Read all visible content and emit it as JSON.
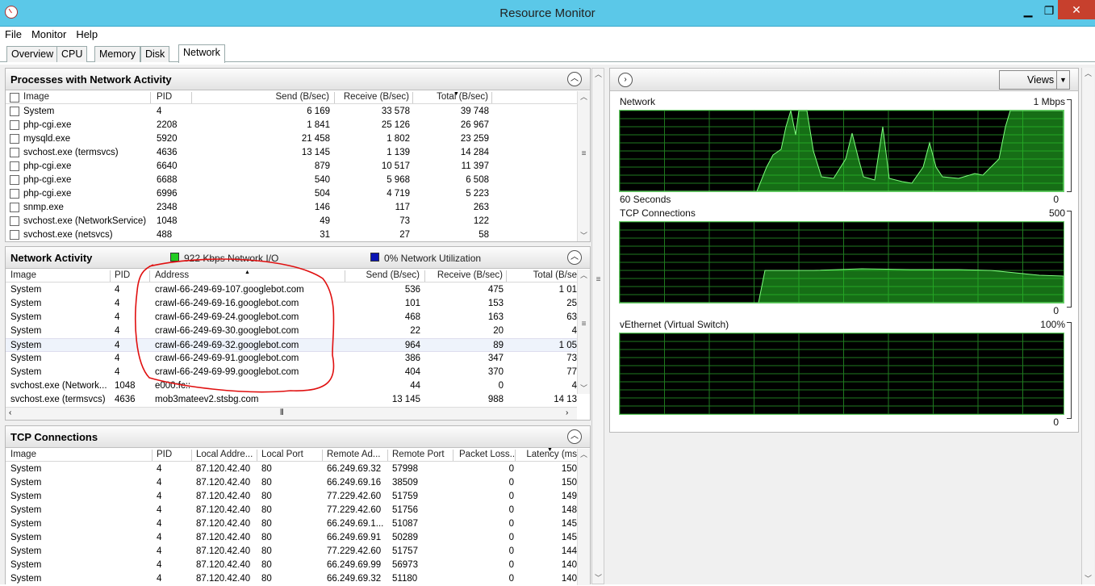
{
  "window": {
    "title": "Resource Monitor",
    "min": "▁",
    "max": "❐",
    "close": "✕"
  },
  "menu": [
    "File",
    "Monitor",
    "Help"
  ],
  "tabs": [
    "Overview",
    "CPU",
    "Memory",
    "Disk",
    "Network"
  ],
  "processes": {
    "title": "Processes with Network Activity",
    "columns": [
      "Image",
      "PID",
      "Send (B/sec)",
      "Receive (B/sec)",
      "Total (B/sec)"
    ],
    "rows": [
      [
        "System",
        "4",
        "6 169",
        "33 578",
        "39 748"
      ],
      [
        "php-cgi.exe",
        "2208",
        "1 841",
        "25 126",
        "26 967"
      ],
      [
        "mysqld.exe",
        "5920",
        "21 458",
        "1 802",
        "23 259"
      ],
      [
        "svchost.exe (termsvcs)",
        "4636",
        "13 145",
        "1 139",
        "14 284"
      ],
      [
        "php-cgi.exe",
        "6640",
        "879",
        "10 517",
        "11 397"
      ],
      [
        "php-cgi.exe",
        "6688",
        "540",
        "5 968",
        "6 508"
      ],
      [
        "php-cgi.exe",
        "6996",
        "504",
        "4 719",
        "5 223"
      ],
      [
        "snmp.exe",
        "2348",
        "146",
        "117",
        "263"
      ],
      [
        "svchost.exe (NetworkService)",
        "1048",
        "49",
        "73",
        "122"
      ],
      [
        "svchost.exe (netsvcs)",
        "488",
        "31",
        "27",
        "58"
      ]
    ]
  },
  "activity": {
    "title": "Network Activity",
    "io_legend": "922 Kbps Network I/O",
    "util_legend": "0% Network Utilization",
    "io_color": "#22cc22",
    "util_color": "#0a14b4",
    "columns": [
      "Image",
      "PID",
      "Address",
      "Send (B/sec)",
      "Receive (B/sec)",
      "Total (B/se"
    ],
    "rows": [
      [
        "System",
        "4",
        "crawl-66-249-69-107.googlebot.com",
        "536",
        "475",
        "1 01"
      ],
      [
        "System",
        "4",
        "crawl-66-249-69-16.googlebot.com",
        "101",
        "153",
        "25"
      ],
      [
        "System",
        "4",
        "crawl-66-249-69-24.googlebot.com",
        "468",
        "163",
        "63"
      ],
      [
        "System",
        "4",
        "crawl-66-249-69-30.googlebot.com",
        "22",
        "20",
        "4"
      ],
      [
        "System",
        "4",
        "crawl-66-249-69-32.googlebot.com",
        "964",
        "89",
        "1 05"
      ],
      [
        "System",
        "4",
        "crawl-66-249-69-91.googlebot.com",
        "386",
        "347",
        "73"
      ],
      [
        "System",
        "4",
        "crawl-66-249-69-99.googlebot.com",
        "404",
        "370",
        "77"
      ],
      [
        "svchost.exe (Network...",
        "1048",
        "e000:fc::",
        "44",
        "0",
        "4"
      ],
      [
        "svchost.exe (termsvcs)",
        "4636",
        "mob3mateev2.stsbg.com",
        "13 145",
        "988",
        "14 13"
      ]
    ]
  },
  "tcp": {
    "title": "TCP Connections",
    "columns": [
      "Image",
      "PID",
      "Local Addre...",
      "Local Port",
      "Remote Ad...",
      "Remote Port",
      "Packet Loss...",
      "Latency (ms"
    ],
    "rows": [
      [
        "System",
        "4",
        "87.120.42.40",
        "80",
        "66.249.69.32",
        "57998",
        "0",
        "150"
      ],
      [
        "System",
        "4",
        "87.120.42.40",
        "80",
        "66.249.69.16",
        "38509",
        "0",
        "150"
      ],
      [
        "System",
        "4",
        "87.120.42.40",
        "80",
        "77.229.42.60",
        "51759",
        "0",
        "149"
      ],
      [
        "System",
        "4",
        "87.120.42.40",
        "80",
        "77.229.42.60",
        "51756",
        "0",
        "148"
      ],
      [
        "System",
        "4",
        "87.120.42.40",
        "80",
        "66.249.69.1...",
        "51087",
        "0",
        "145"
      ],
      [
        "System",
        "4",
        "87.120.42.40",
        "80",
        "66.249.69.91",
        "50289",
        "0",
        "145"
      ],
      [
        "System",
        "4",
        "87.120.42.40",
        "80",
        "77.229.42.60",
        "51757",
        "0",
        "144"
      ],
      [
        "System",
        "4",
        "87.120.42.40",
        "80",
        "66.249.69.99",
        "56973",
        "0",
        "140"
      ],
      [
        "System",
        "4",
        "87.120.42.40",
        "80",
        "66.249.69.32",
        "51180",
        "0",
        "140"
      ]
    ]
  },
  "right": {
    "views_label": "Views",
    "graphs": [
      {
        "label": "Network",
        "max": "1 Mbps",
        "bottom_left": "60 Seconds",
        "bottom_right": "0"
      },
      {
        "label": "TCP Connections",
        "max": "500",
        "bottom_left": "",
        "bottom_right": "0"
      },
      {
        "label": "vEthernet (Virtual Switch)",
        "max": "100%",
        "bottom_left": "",
        "bottom_right": "0"
      }
    ]
  }
}
